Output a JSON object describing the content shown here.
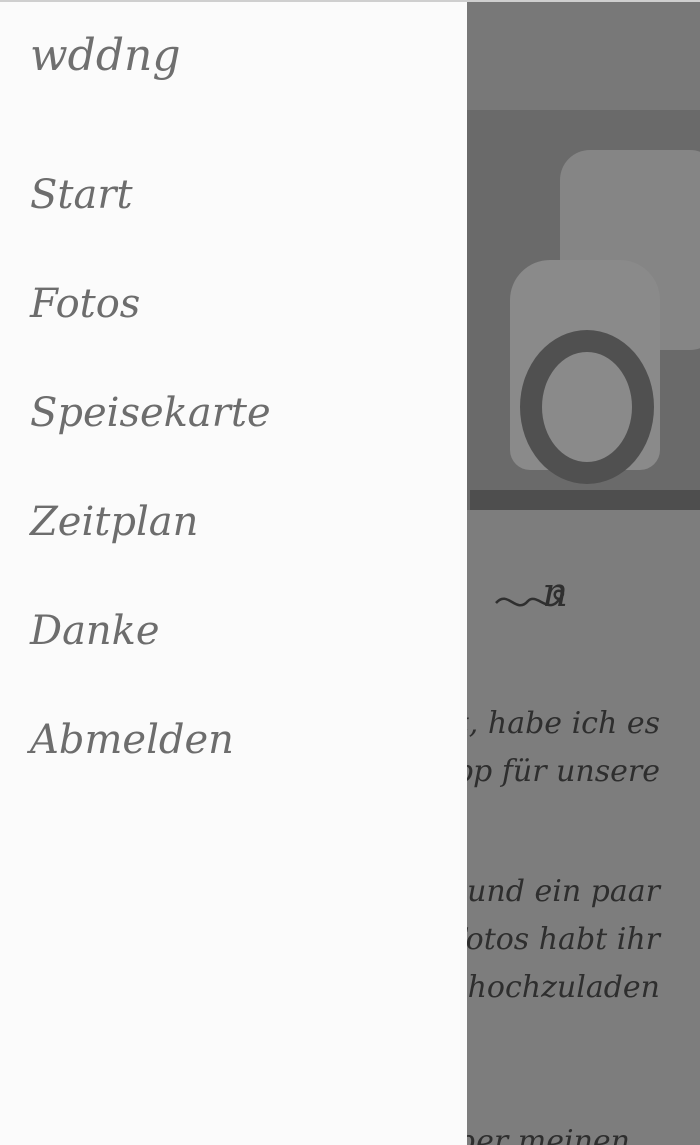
{
  "drawer": {
    "app_title": "wddng",
    "items": [
      {
        "label": "Start"
      },
      {
        "label": "Fotos"
      },
      {
        "label": "Speisekarte"
      },
      {
        "label": "Zeitplan"
      },
      {
        "label": "Danke"
      },
      {
        "label": "Abmelden"
      }
    ]
  },
  "background": {
    "heading_fragment": "n",
    "paragraph1": "ist, habe ich es\nApp für unsere",
    "paragraph2": "s und ein paar\nFotos habt ihr\nhochzuladen",
    "paragraph3": "über meinen"
  },
  "colors": {
    "drawer_bg": "#fbfbfb",
    "scrim": "#7a7a7a",
    "menu_text": "#6d6d6d"
  }
}
